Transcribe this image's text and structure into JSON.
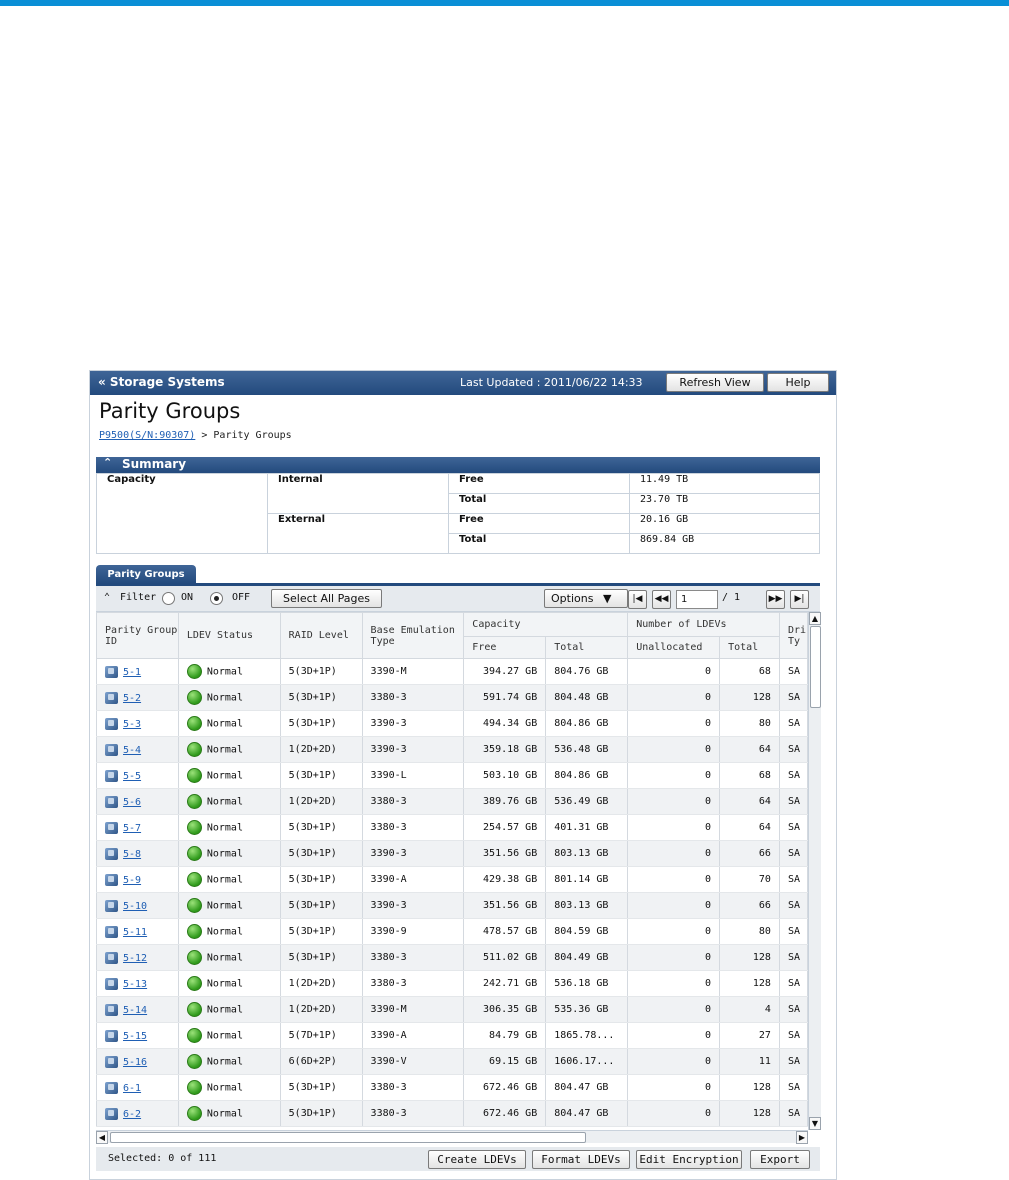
{
  "header": {
    "title": "« Storage Systems",
    "last_updated_label": "Last Updated : 2011/06/22 14:33",
    "refresh_label": "Refresh View",
    "help_label": "Help"
  },
  "page_title": "Parity Groups",
  "breadcrumb": {
    "link": "P9500(S/N:90307)",
    "current": "> Parity Groups"
  },
  "summary": {
    "title": "Summary",
    "capacity_label": "Capacity",
    "internal_label": "Internal",
    "external_label": "External",
    "free_label": "Free",
    "total_label": "Total",
    "internal_free": "11.49 TB",
    "internal_total": "23.70 TB",
    "external_free": "20.16 GB",
    "external_total": "869.84 GB"
  },
  "tab_label": "Parity Groups",
  "toolbar": {
    "filter_label": "Filter",
    "on_label": "ON",
    "off_label": "OFF",
    "select_all_label": "Select All Pages",
    "options_label": "Options",
    "page_value": "1",
    "page_total": "/ 1"
  },
  "columns": {
    "parity_group_id": "Parity Group ID",
    "ldev_status": "LDEV Status",
    "raid_level": "RAID Level",
    "base_emulation_type": "Base Emulation Type",
    "capacity": "Capacity",
    "free": "Free",
    "total": "Total",
    "number_of_ldevs": "Number of LDEVs",
    "unallocated": "Unallocated",
    "ldev_total": "Total",
    "drive_type": "Dri Ty"
  },
  "rows": [
    {
      "id": "5-1",
      "status": "Normal",
      "raid": "5(3D+1P)",
      "emu": "3390-M",
      "free": "394.27 GB",
      "total": "804.76 GB",
      "unalloc": "0",
      "ldevs": "68",
      "drive": "SA"
    },
    {
      "id": "5-2",
      "status": "Normal",
      "raid": "5(3D+1P)",
      "emu": "3380-3",
      "free": "591.74 GB",
      "total": "804.48 GB",
      "unalloc": "0",
      "ldevs": "128",
      "drive": "SA"
    },
    {
      "id": "5-3",
      "status": "Normal",
      "raid": "5(3D+1P)",
      "emu": "3390-3",
      "free": "494.34 GB",
      "total": "804.86 GB",
      "unalloc": "0",
      "ldevs": "80",
      "drive": "SA"
    },
    {
      "id": "5-4",
      "status": "Normal",
      "raid": "1(2D+2D)",
      "emu": "3390-3",
      "free": "359.18 GB",
      "total": "536.48 GB",
      "unalloc": "0",
      "ldevs": "64",
      "drive": "SA"
    },
    {
      "id": "5-5",
      "status": "Normal",
      "raid": "5(3D+1P)",
      "emu": "3390-L",
      "free": "503.10 GB",
      "total": "804.86 GB",
      "unalloc": "0",
      "ldevs": "68",
      "drive": "SA"
    },
    {
      "id": "5-6",
      "status": "Normal",
      "raid": "1(2D+2D)",
      "emu": "3380-3",
      "free": "389.76 GB",
      "total": "536.49 GB",
      "unalloc": "0",
      "ldevs": "64",
      "drive": "SA"
    },
    {
      "id": "5-7",
      "status": "Normal",
      "raid": "5(3D+1P)",
      "emu": "3380-3",
      "free": "254.57 GB",
      "total": "401.31 GB",
      "unalloc": "0",
      "ldevs": "64",
      "drive": "SA"
    },
    {
      "id": "5-8",
      "status": "Normal",
      "raid": "5(3D+1P)",
      "emu": "3390-3",
      "free": "351.56 GB",
      "total": "803.13 GB",
      "unalloc": "0",
      "ldevs": "66",
      "drive": "SA"
    },
    {
      "id": "5-9",
      "status": "Normal",
      "raid": "5(3D+1P)",
      "emu": "3390-A",
      "free": "429.38 GB",
      "total": "801.14 GB",
      "unalloc": "0",
      "ldevs": "70",
      "drive": "SA"
    },
    {
      "id": "5-10",
      "status": "Normal",
      "raid": "5(3D+1P)",
      "emu": "3390-3",
      "free": "351.56 GB",
      "total": "803.13 GB",
      "unalloc": "0",
      "ldevs": "66",
      "drive": "SA"
    },
    {
      "id": "5-11",
      "status": "Normal",
      "raid": "5(3D+1P)",
      "emu": "3390-9",
      "free": "478.57 GB",
      "total": "804.59 GB",
      "unalloc": "0",
      "ldevs": "80",
      "drive": "SA"
    },
    {
      "id": "5-12",
      "status": "Normal",
      "raid": "5(3D+1P)",
      "emu": "3380-3",
      "free": "511.02 GB",
      "total": "804.49 GB",
      "unalloc": "0",
      "ldevs": "128",
      "drive": "SA"
    },
    {
      "id": "5-13",
      "status": "Normal",
      "raid": "1(2D+2D)",
      "emu": "3380-3",
      "free": "242.71 GB",
      "total": "536.18 GB",
      "unalloc": "0",
      "ldevs": "128",
      "drive": "SA"
    },
    {
      "id": "5-14",
      "status": "Normal",
      "raid": "1(2D+2D)",
      "emu": "3390-M",
      "free": "306.35 GB",
      "total": "535.36 GB",
      "unalloc": "0",
      "ldevs": "4",
      "drive": "SA"
    },
    {
      "id": "5-15",
      "status": "Normal",
      "raid": "5(7D+1P)",
      "emu": "3390-A",
      "free": "84.79 GB",
      "total": "1865.78...",
      "unalloc": "0",
      "ldevs": "27",
      "drive": "SA"
    },
    {
      "id": "5-16",
      "status": "Normal",
      "raid": "6(6D+2P)",
      "emu": "3390-V",
      "free": "69.15 GB",
      "total": "1606.17...",
      "unalloc": "0",
      "ldevs": "11",
      "drive": "SA"
    },
    {
      "id": "6-1",
      "status": "Normal",
      "raid": "5(3D+1P)",
      "emu": "3380-3",
      "free": "672.46 GB",
      "total": "804.47 GB",
      "unalloc": "0",
      "ldevs": "128",
      "drive": "SA"
    },
    {
      "id": "6-2",
      "status": "Normal",
      "raid": "5(3D+1P)",
      "emu": "3380-3",
      "free": "672.46 GB",
      "total": "804.47 GB",
      "unalloc": "0",
      "ldevs": "128",
      "drive": "SA"
    }
  ],
  "footer": {
    "selected_text": "Selected:  0   of  111",
    "create_label": "Create LDEVs",
    "format_label": "Format LDEVs",
    "encrypt_label": "Edit Encryption",
    "export_label": "Export"
  },
  "colors": {
    "accent": "#0a8fd6",
    "header": "#234a7d",
    "link": "#1f5fb4",
    "status_normal": "#2f9a1b"
  }
}
